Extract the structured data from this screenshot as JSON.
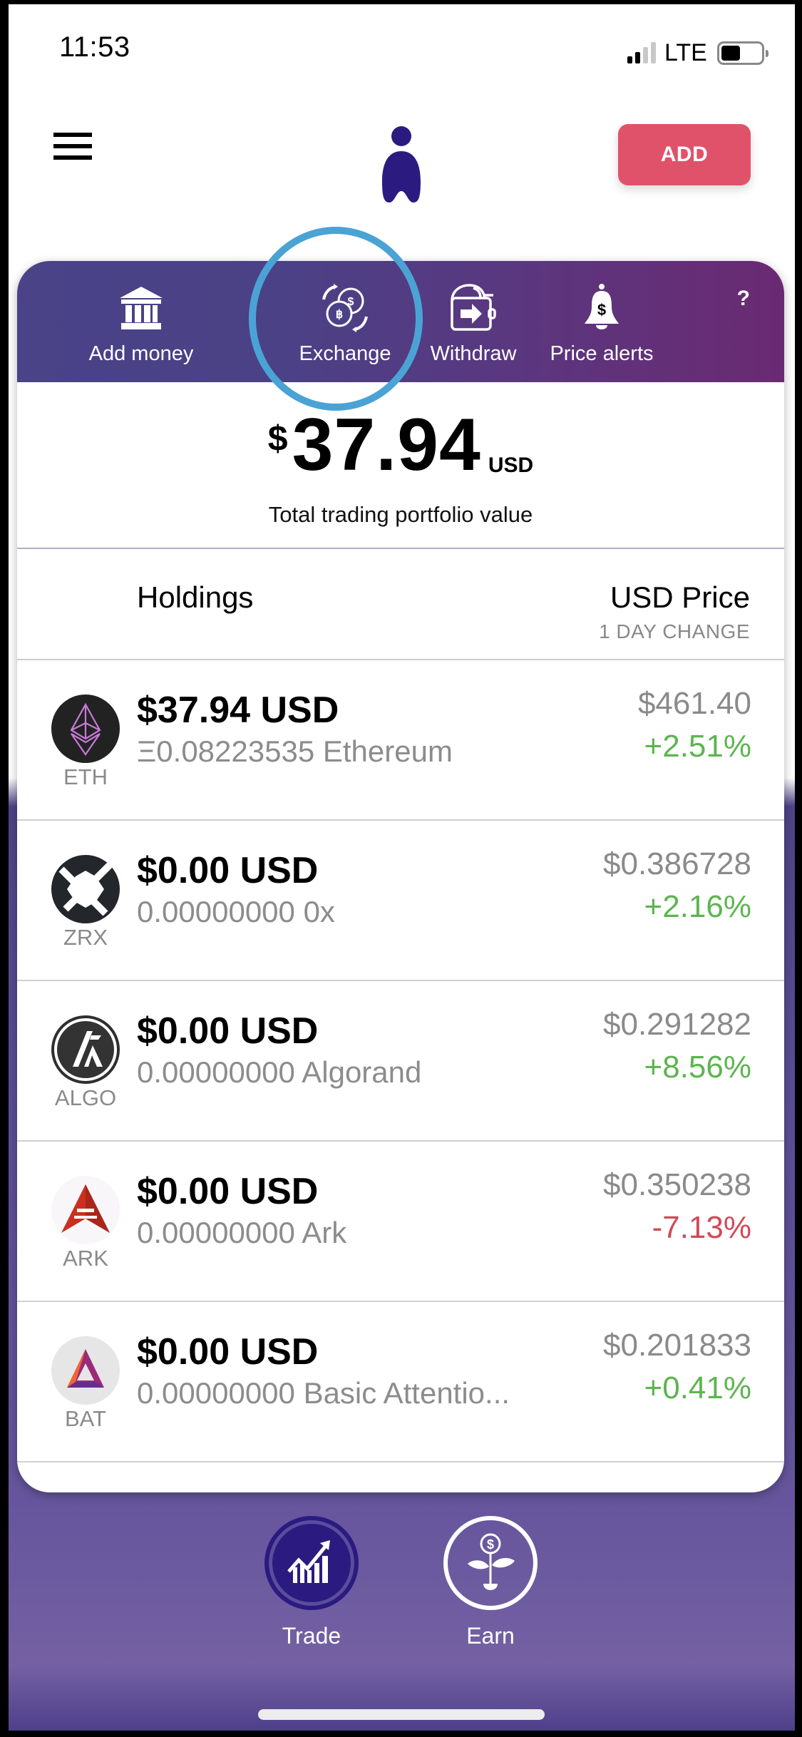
{
  "status_bar": {
    "time": "11:53",
    "network": "LTE",
    "signal_bars": 4,
    "signal_active": 2
  },
  "header": {
    "menu_icon": "hamburger-icon",
    "logo": "person-logo",
    "add_label": "ADD",
    "colors": {
      "add_button": "#e0526a",
      "logo": "#2b1b80"
    }
  },
  "actions": [
    {
      "label": "Add money",
      "icon": "bank-icon"
    },
    {
      "label": "Exchange",
      "icon": "exchange-coins-icon"
    },
    {
      "label": "Withdraw",
      "icon": "wallet-withdraw-icon"
    },
    {
      "label": "Price alerts",
      "icon": "bell-dollar-icon"
    }
  ],
  "help_label": "?",
  "portfolio": {
    "currency_symbol": "$",
    "value": "37.94",
    "currency": "USD",
    "caption": "Total trading portfolio value"
  },
  "table_header": {
    "left": "Holdings",
    "right": "USD Price",
    "right_sub": "1 DAY CHANGE"
  },
  "holdings": [
    {
      "ticker": "ETH",
      "usd_value": "$37.94 USD",
      "quantity": "Ξ0.08223535 Ethereum",
      "price": "$461.40",
      "change": "+2.51%",
      "direction": "up",
      "icon": "ethereum-icon"
    },
    {
      "ticker": "ZRX",
      "usd_value": "$0.00 USD",
      "quantity": "0.00000000 0x",
      "price": "$0.386728",
      "change": "+2.16%",
      "direction": "up",
      "icon": "zrx-icon"
    },
    {
      "ticker": "ALGO",
      "usd_value": "$0.00 USD",
      "quantity": "0.00000000 Algorand",
      "price": "$0.291282",
      "change": "+8.56%",
      "direction": "up",
      "icon": "algorand-icon"
    },
    {
      "ticker": "ARK",
      "usd_value": "$0.00 USD",
      "quantity": "0.00000000 Ark",
      "price": "$0.350238",
      "change": "-7.13%",
      "direction": "down",
      "icon": "ark-icon"
    },
    {
      "ticker": "BAT",
      "usd_value": "$0.00 USD",
      "quantity": "0.00000000 Basic Attentio...",
      "price": "$0.201833",
      "change": "+0.41%",
      "direction": "up",
      "icon": "bat-icon"
    }
  ],
  "bottom_nav": [
    {
      "label": "Trade",
      "icon": "chart-growth-icon",
      "active": true
    },
    {
      "label": "Earn",
      "icon": "money-plant-icon",
      "active": false
    }
  ],
  "colors": {
    "positive": "#5cb54f",
    "negative": "#d04a58",
    "action_band_start": "#4a4388",
    "action_band_end": "#6a2a72",
    "annotation": "#4aa3d4"
  }
}
